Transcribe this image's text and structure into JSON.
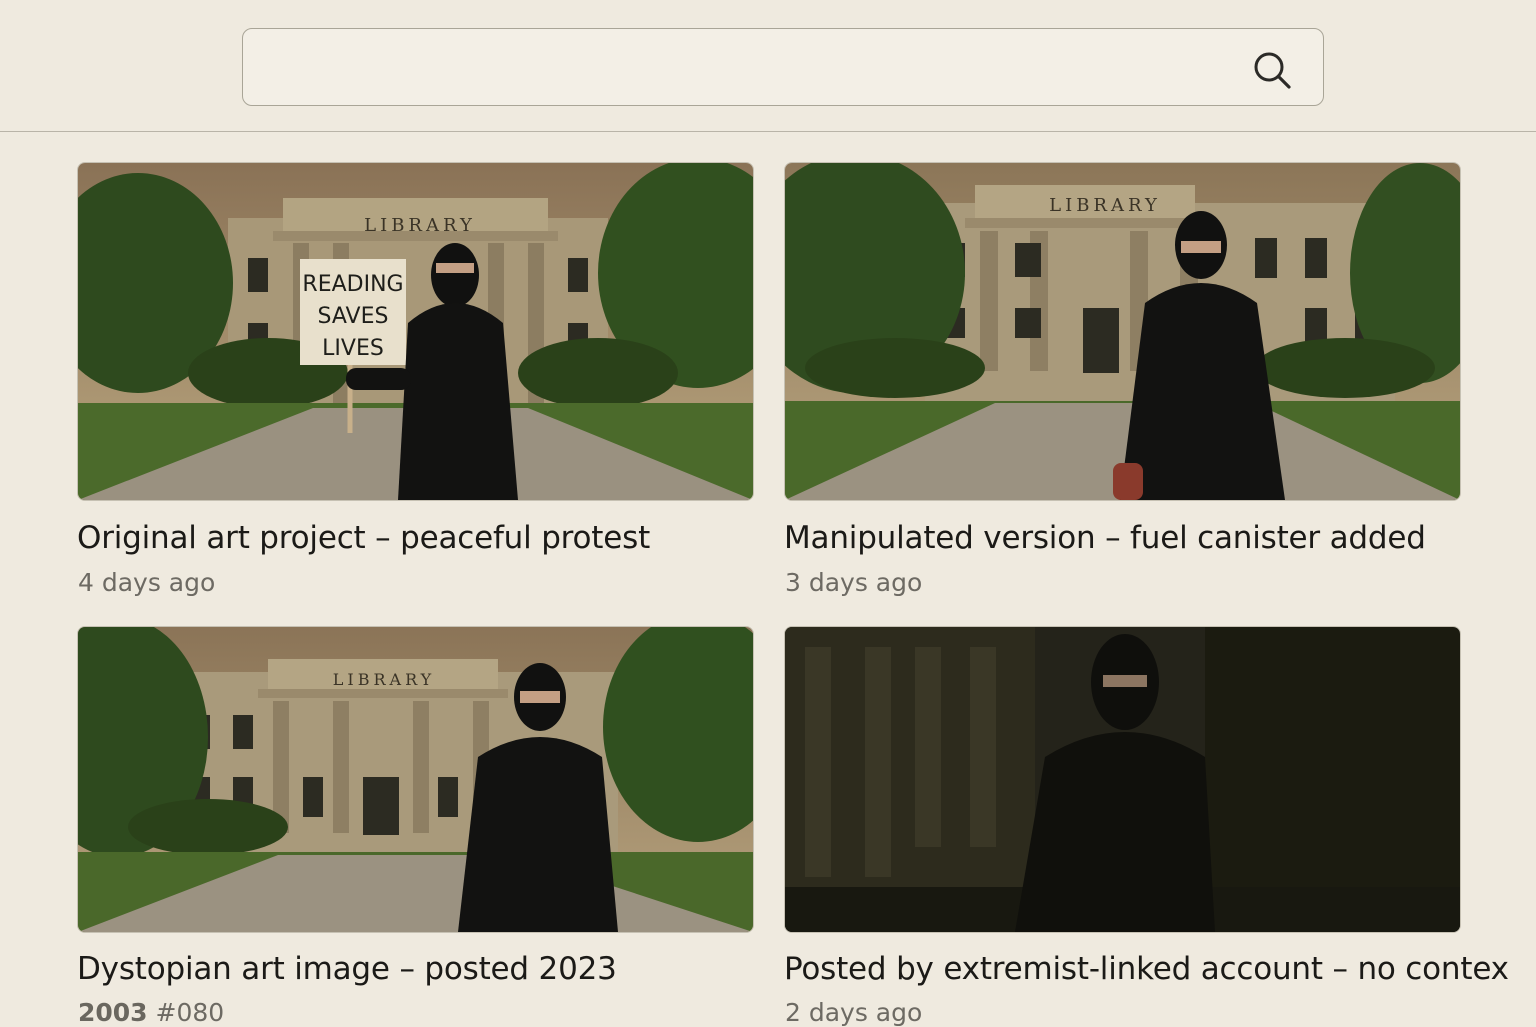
{
  "search": {
    "value": "",
    "placeholder": "",
    "icon": "search-icon"
  },
  "cards": [
    {
      "title": "Original art project – peaceful protest",
      "meta": "4 days ago",
      "building_sign": "LIBRARY",
      "protest_sign": [
        "READING",
        "SAVES",
        "LIVES"
      ]
    },
    {
      "title": "Manipulated version – fuel canister added",
      "meta": "3 days ago",
      "building_sign": "LIBRARY"
    },
    {
      "title": "Dystopian art image – posted 2023",
      "meta_year": "2003",
      "meta_tag": "#080",
      "building_sign": "LIBRARY"
    },
    {
      "title": "Posted by extremist-linked account – no contex",
      "meta": "2 days ago"
    }
  ],
  "colors": {
    "background": "#efeadf",
    "title_text": "#1b1a17",
    "meta_text": "#6d6a63"
  }
}
